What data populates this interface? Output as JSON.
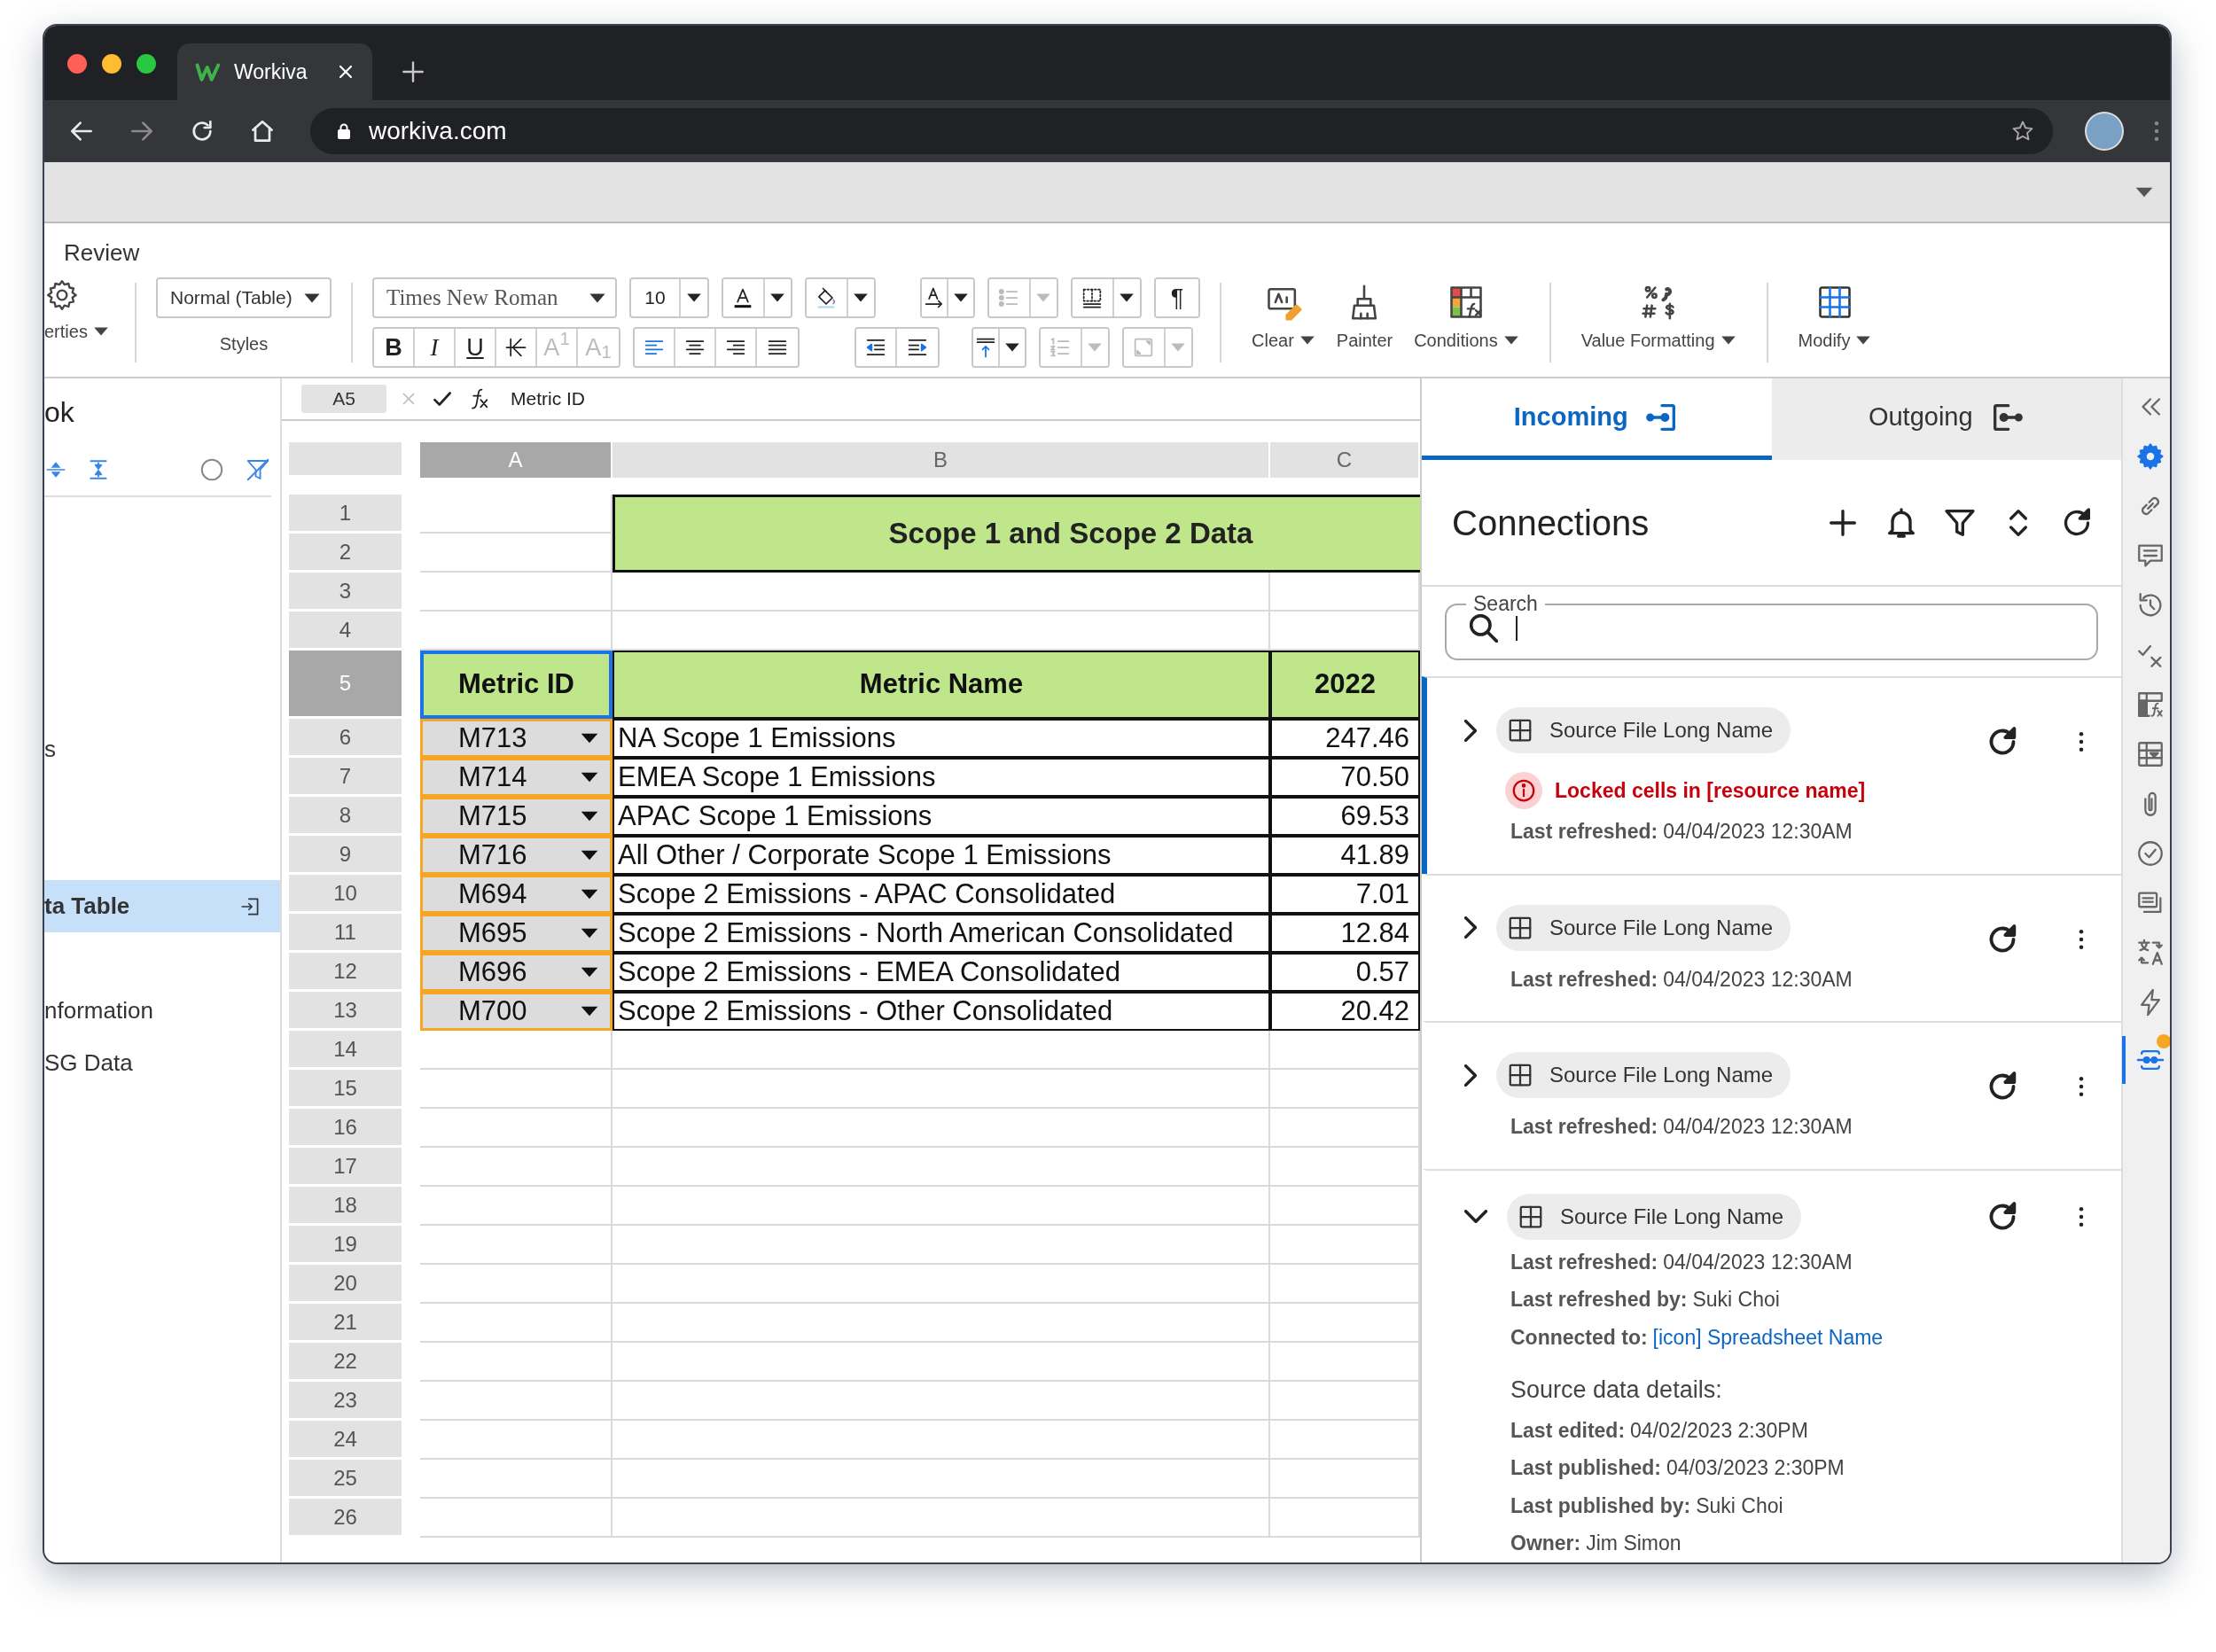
{
  "browser": {
    "tab_title": "Workiva",
    "url": "workiva.com"
  },
  "ribbon": {
    "menu_label": "Review",
    "properties_label": "erties",
    "style_value": "Normal (Table)",
    "styles_label": "Styles",
    "font_value": "Times New Roman",
    "size_value": "10",
    "tools": [
      {
        "kind": "icon",
        "disabled": false
      },
      {
        "kind": "icon",
        "disabled": false
      },
      {
        "kind": "icon",
        "disabled": false
      },
      {
        "kind": "icon",
        "disabled": true
      },
      {
        "kind": "icon",
        "disabled": false
      },
      {
        "kind": "text",
        "label": "¶",
        "disabled": false
      },
      {
        "kind": "text",
        "label": "B",
        "disabled": false
      },
      {
        "kind": "text",
        "label": "I",
        "disabled": false
      },
      {
        "kind": "text",
        "label": "U",
        "disabled": false
      },
      {
        "kind": "icon",
        "disabled": false
      },
      {
        "kind": "text",
        "label": "A$^{1}$",
        "disabled": true
      },
      {
        "kind": "text",
        "label": "A$_{1}$",
        "disabled": true
      },
      {
        "kind": "icon",
        "disabled": false
      },
      {
        "kind": "icon",
        "disabled": false
      },
      {
        "kind": "icon",
        "disabled": false
      },
      {
        "kind": "icon",
        "disabled": false
      },
      {
        "kind": "icon",
        "disabled": false
      },
      {
        "kind": "icon",
        "disabled": false
      },
      {
        "kind": "icon",
        "disabled": false
      },
      {
        "kind": "icon",
        "disabled": true
      },
      {
        "kind": "icon",
        "disabled": true
      }
    ],
    "actions": [
      {
        "label": "Clear",
        "dropdown": true
      },
      {
        "label": "Painter",
        "dropdown": false
      },
      {
        "label": "Conditions",
        "dropdown": true
      },
      {
        "label": "Value Formatting",
        "dropdown": true
      },
      {
        "label": "Modify",
        "dropdown": true
      }
    ]
  },
  "sidebar": {
    "title": "ok",
    "items": [
      {
        "label": "s",
        "selected": false
      },
      {
        "label": "ta Table",
        "selected": true
      },
      {
        "label": "nformation",
        "selected": false
      },
      {
        "label": "SG Data",
        "selected": false
      }
    ]
  },
  "formula_bar": {
    "cell_ref": "A5",
    "formula": "Metric ID"
  },
  "sheet": {
    "columns": [
      {
        "label": "A",
        "selected": true
      },
      {
        "label": "B",
        "selected": false
      },
      {
        "label": "C",
        "selected": false
      }
    ],
    "rows": [
      {
        "label": "1",
        "selected": false
      },
      {
        "label": "2",
        "selected": false
      },
      {
        "label": "3",
        "selected": false
      },
      {
        "label": "4",
        "selected": false
      },
      {
        "label": "5",
        "selected": true
      },
      {
        "label": "6",
        "selected": false
      },
      {
        "label": "7",
        "selected": false
      },
      {
        "label": "8",
        "selected": false
      },
      {
        "label": "9",
        "selected": false
      },
      {
        "label": "10",
        "selected": false
      },
      {
        "label": "11",
        "selected": false
      },
      {
        "label": "12",
        "selected": false
      },
      {
        "label": "13",
        "selected": false
      },
      {
        "label": "14",
        "selected": false
      },
      {
        "label": "15",
        "selected": false
      },
      {
        "label": "16",
        "selected": false
      },
      {
        "label": "17",
        "selected": false
      },
      {
        "label": "18",
        "selected": false
      },
      {
        "label": "19",
        "selected": false
      },
      {
        "label": "20",
        "selected": false
      },
      {
        "label": "21",
        "selected": false
      },
      {
        "label": "22",
        "selected": false
      },
      {
        "label": "23",
        "selected": false
      },
      {
        "label": "24",
        "selected": false
      },
      {
        "label": "25",
        "selected": false
      },
      {
        "label": "26",
        "selected": false
      }
    ],
    "title": "Scope 1 and Scope 2 Data",
    "table_header": [
      "Metric ID",
      "Metric Name",
      "2022"
    ],
    "table_rows": [
      {
        "id": "M713",
        "name": "NA Scope 1 Emissions",
        "value": "247.46"
      },
      {
        "id": "M714",
        "name": "EMEA Scope 1 Emissions",
        "value": "70.50"
      },
      {
        "id": "M715",
        "name": "APAC Scope 1 Emissions",
        "value": "69.53"
      },
      {
        "id": "M716",
        "name": "All Other / Corporate Scope 1 Emissions",
        "value": "41.89"
      },
      {
        "id": "M694",
        "name": "Scope 2 Emissions - APAC Consolidated",
        "value": "7.01"
      },
      {
        "id": "M695",
        "name": "Scope 2 Emissions - North American Consolidated",
        "value": "12.84"
      },
      {
        "id": "M696",
        "name": "Scope 2 Emissions - EMEA Consolidated",
        "value": "0.57"
      },
      {
        "id": "M700",
        "name": "Scope 2 Emissions - Other Consolidated",
        "value": "20.42"
      }
    ]
  },
  "connections_panel": {
    "tabs": [
      {
        "label": "Incoming",
        "selected": true
      },
      {
        "label": "Outgoing",
        "selected": false
      }
    ],
    "title": "Connections",
    "search": {
      "label": "Search"
    },
    "items": [
      {
        "name": "Source File Long Name",
        "expanded": false,
        "selected": true,
        "error": "Locked cells in [resource name]",
        "details": [
          {
            "label": "Last refreshed:",
            "value": "04/04/2023 12:30AM"
          }
        ]
      },
      {
        "name": "Source File Long Name",
        "expanded": false,
        "selected": false,
        "details": [
          {
            "label": "Last refreshed:",
            "value": "04/04/2023 12:30AM"
          }
        ]
      },
      {
        "name": "Source File Long Name",
        "expanded": false,
        "selected": false,
        "details": [
          {
            "label": "Last refreshed:",
            "value": "04/04/2023 12:30AM"
          }
        ]
      },
      {
        "name": "Source File Long Name",
        "expanded": true,
        "selected": false,
        "details": [
          {
            "label": "Last refreshed:",
            "value": "04/04/2023 12:30AM"
          },
          {
            "label": "Last refreshed by:",
            "value": "Suki Choi"
          },
          {
            "label": "Connected to:",
            "link": "[icon] Spreadsheet Name"
          }
        ],
        "section_title": "Source data details:",
        "section_details": [
          {
            "label": "Last edited:",
            "value": "04/02/2023 2:30PM"
          },
          {
            "label": "Last published:",
            "value": "04/03/2023 2:30PM"
          },
          {
            "label": "Last published by:",
            "value": "Suki Choi"
          },
          {
            "label": "Owner:",
            "value": "Jim Simon"
          }
        ]
      }
    ]
  },
  "tool_rail": [
    {
      "selected": false,
      "highlighted": false,
      "badge": false
    },
    {
      "selected": false,
      "highlighted": true,
      "badge": false
    },
    {
      "selected": false,
      "highlighted": false,
      "badge": false
    },
    {
      "selected": false,
      "highlighted": false,
      "badge": false
    },
    {
      "selected": false,
      "highlighted": false,
      "badge": false
    },
    {
      "selected": false,
      "highlighted": false,
      "badge": false
    },
    {
      "selected": false,
      "highlighted": false,
      "badge": false
    },
    {
      "selected": false,
      "highlighted": false,
      "badge": false
    },
    {
      "selected": false,
      "highlighted": false,
      "badge": false
    },
    {
      "selected": false,
      "highlighted": false,
      "badge": false
    },
    {
      "selected": false,
      "highlighted": false,
      "badge": false
    },
    {
      "selected": false,
      "highlighted": false,
      "badge": false
    },
    {
      "selected": false,
      "highlighted": false,
      "badge": false
    },
    {
      "selected": true,
      "highlighted": false,
      "badge": true
    }
  ]
}
